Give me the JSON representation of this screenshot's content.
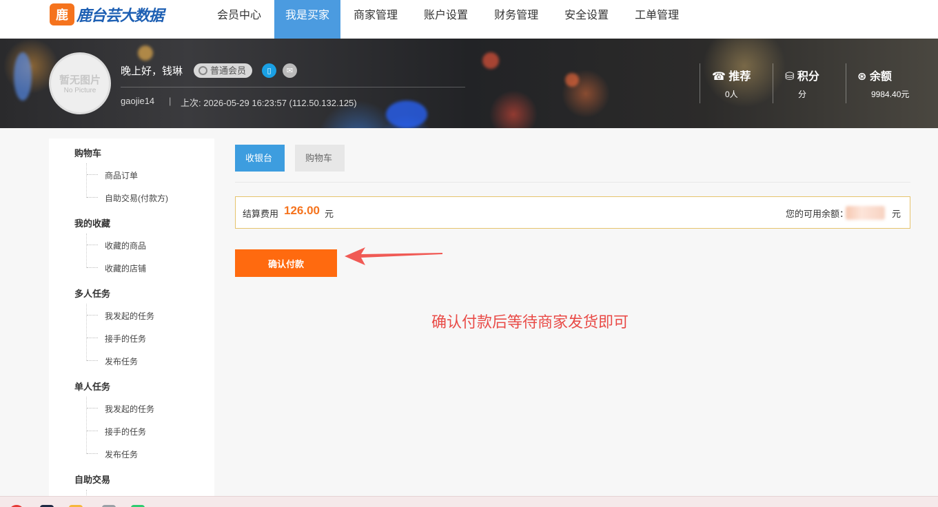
{
  "logo": {
    "mark": "鹿",
    "text": "鹿台芸大数据"
  },
  "nav": [
    {
      "label": "会员中心",
      "active": false
    },
    {
      "label": "我是买家",
      "active": true
    },
    {
      "label": "商家管理",
      "active": false
    },
    {
      "label": "账户设置",
      "active": false
    },
    {
      "label": "财务管理",
      "active": false
    },
    {
      "label": "安全设置",
      "active": false
    },
    {
      "label": "工单管理",
      "active": false
    }
  ],
  "profile": {
    "avatar_line1": "暂无图片",
    "avatar_line2": "No Picture",
    "greeting": "晚上好，钱琳",
    "level_badge": "普通会员",
    "username": "gaojie14",
    "separator": "|",
    "last_login": "上次: 2026-05-29 16:23:57 (112.50.132.125)"
  },
  "stats": [
    {
      "icon": "☎",
      "title": "推荐",
      "value": "0人"
    },
    {
      "icon": "⛁",
      "title": "积分",
      "value": "分"
    },
    {
      "icon": "⊛",
      "title": "余额",
      "value": "9984.40元"
    }
  ],
  "sidebar": {
    "groups": [
      {
        "title": "购物车",
        "items": [
          "商品订单",
          "自助交易(付款方)"
        ]
      },
      {
        "title": "我的收藏",
        "items": [
          "收藏的商品",
          "收藏的店铺"
        ]
      },
      {
        "title": "多人任务",
        "items": [
          "我发起的任务",
          "接手的任务",
          "发布任务"
        ]
      },
      {
        "title": "单人任务",
        "items": [
          "我发起的任务",
          "接手的任务",
          "发布任务"
        ]
      },
      {
        "title": "自助交易",
        "items": []
      }
    ]
  },
  "tabs": {
    "cashier": "收银台",
    "cart": "购物车"
  },
  "payment": {
    "label": "结算费用",
    "amount": "126.00",
    "unit": "元",
    "balance_label": "您的可用余额：",
    "balance_unit": "元"
  },
  "confirm_button": "确认付款",
  "annotation": "确认付款后等待商家发货即可",
  "colors": {
    "accent": "#ff6a0f",
    "nav_active": "#4b9be0",
    "annotation": "#e94b47"
  }
}
